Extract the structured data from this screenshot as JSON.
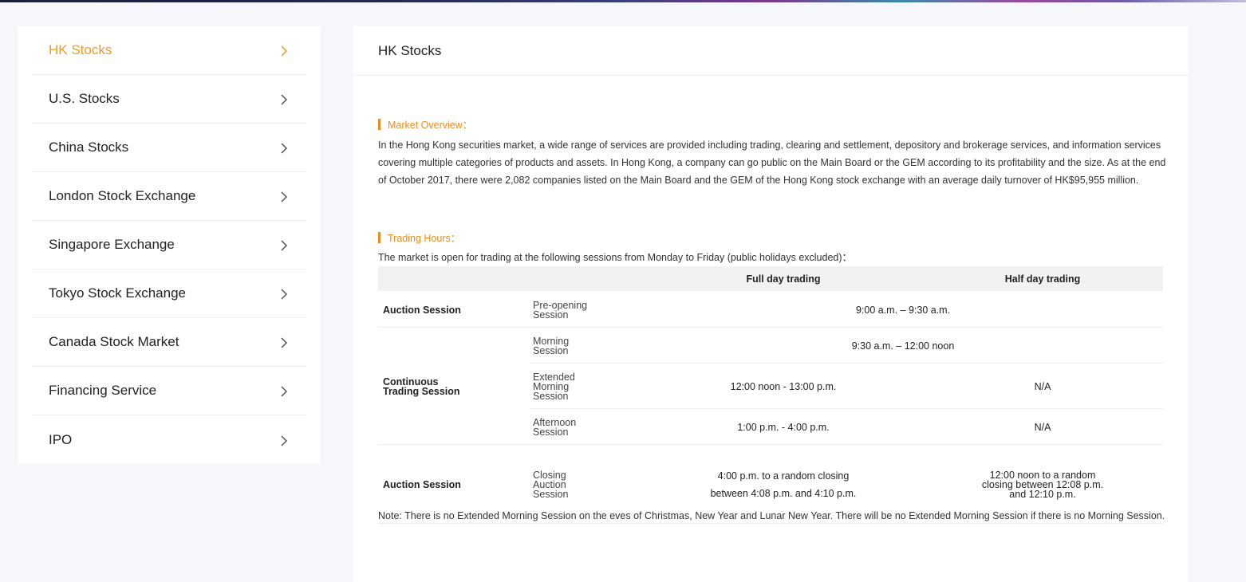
{
  "sidebar": {
    "items": [
      {
        "label": "HK Stocks",
        "active": true
      },
      {
        "label": "U.S. Stocks",
        "active": false
      },
      {
        "label": "China Stocks",
        "active": false
      },
      {
        "label": "London Stock Exchange",
        "active": false
      },
      {
        "label": "Singapore Exchange",
        "active": false
      },
      {
        "label": "Tokyo Stock Exchange",
        "active": false
      },
      {
        "label": "Canada Stock Market",
        "active": false
      },
      {
        "label": "Financing Service",
        "active": false
      },
      {
        "label": "IPO",
        "active": false
      }
    ]
  },
  "main": {
    "title": "HK Stocks",
    "market_overview": {
      "heading": "Market Overview：",
      "text": "In the Hong Kong securities market, a wide range of services are provided including trading, clearing and settlement, depository and brokerage services, and information services covering multiple categories of products and assets. In Hong Kong, a company can go public on the Main Board or the GEM according to its profitability and the size. As at the end of October 2017, there were 2,082 companies listed on the Main Board and the GEM of the Hong Kong stock exchange with an average daily turnover of HK$95,955 million."
    },
    "trading_hours": {
      "heading": "Trading Hours：",
      "intro": "The market is open for trading at the following sessions from Monday to Friday (public holidays excluded)：",
      "table": {
        "headers": {
          "full": "Full day trading",
          "half": "Half day trading"
        },
        "auction1": {
          "label": "Auction Session",
          "sub": "Pre-opening\nSession",
          "both": "9:00 a.m. – 9:30 a.m."
        },
        "continuous": {
          "label": "Continuous\nTrading Session"
        },
        "morning": {
          "sub": "Morning\nSession",
          "both": "9:30 a.m. – 12:00 noon"
        },
        "extended": {
          "sub": "Extended\nMorning\nSession",
          "full": "12:00 noon - 13:00 p.m.",
          "half": "N/A"
        },
        "afternoon": {
          "sub": "Afternoon\nSession",
          "full": "1:00 p.m. - 4:00 p.m.",
          "half": "N/A"
        },
        "auction2": {
          "label": "Auction Session",
          "sub": "Closing\nAuction\nSession",
          "full_line1": "4:00 p.m. to a random closing",
          "full_line2": "between 4:08 p.m. and 4:10 p.m.",
          "half": "12:00 noon to a random\nclosing between 12:08 p.m.\nand 12:10 p.m."
        }
      }
    },
    "note": "Note: There is no Extended Morning Session  on the eves of Christmas, New Year and Lunar New Year.  There will be no Extended Morning Session if there is no Morning Session."
  },
  "colors": {
    "accent": "#f08a1c",
    "active_label": "#f39a21"
  }
}
